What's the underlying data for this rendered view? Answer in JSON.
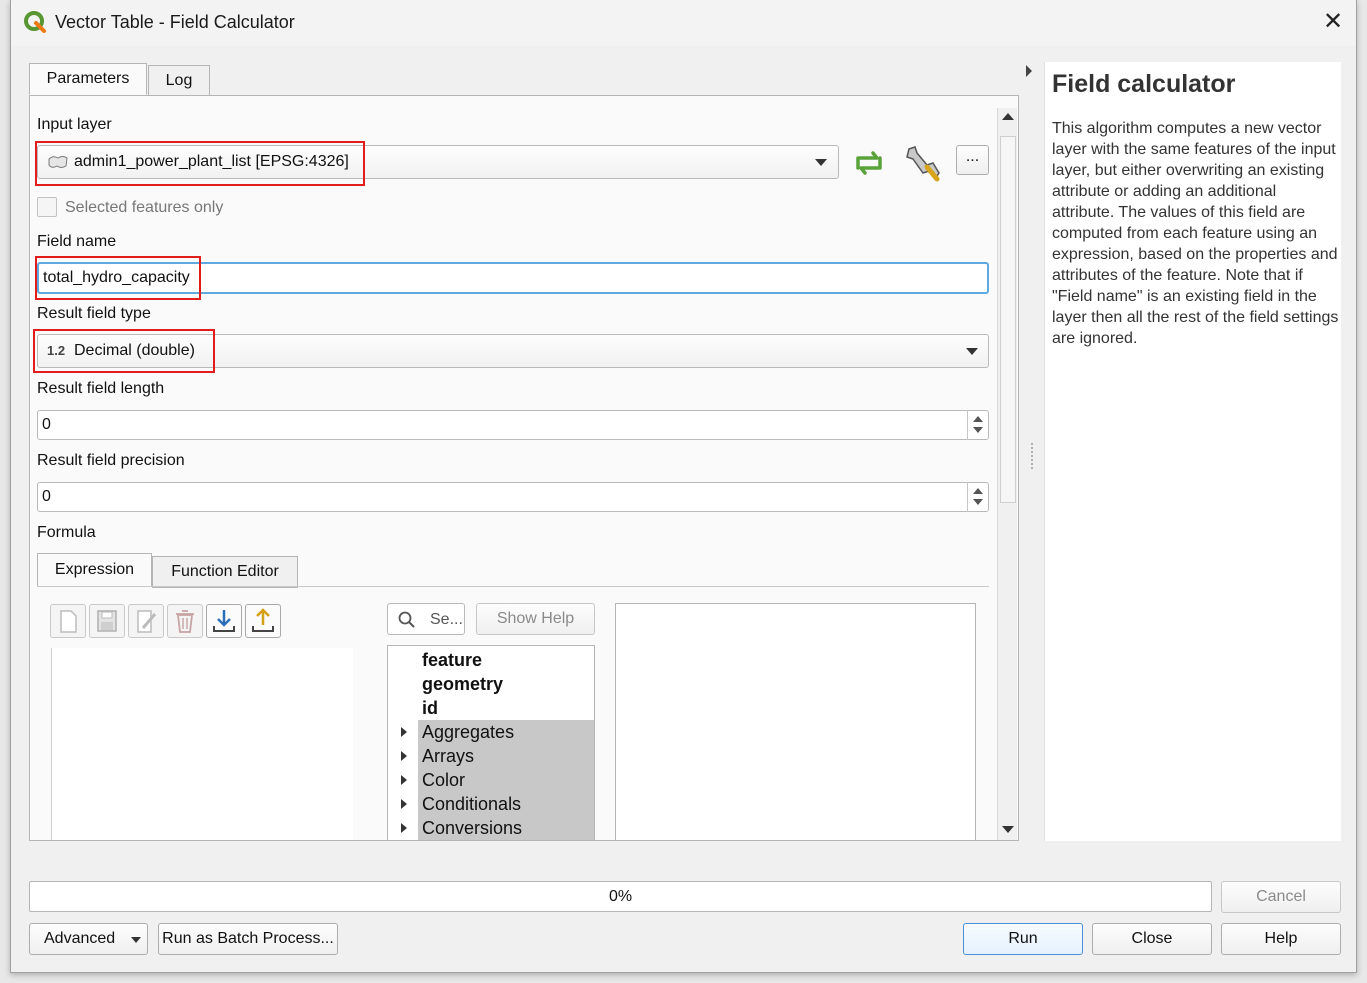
{
  "window": {
    "title": "Vector Table - Field Calculator"
  },
  "tabs": {
    "parameters": "Parameters",
    "log": "Log"
  },
  "input_layer": {
    "label": "Input layer",
    "value": "admin1_power_plant_list [EPSG:4326]",
    "more": "..."
  },
  "selected_only": {
    "label": "Selected features only",
    "checked": false
  },
  "field_name": {
    "label": "Field name",
    "value": "total_hydro_capacity"
  },
  "result_type": {
    "label": "Result field type",
    "icon_text": "1.2",
    "value": "Decimal (double)"
  },
  "field_length": {
    "label": "Result field length",
    "value": "0"
  },
  "field_precision": {
    "label": "Result field precision",
    "value": "0"
  },
  "formula": {
    "label": "Formula",
    "tabs": {
      "expression": "Expression",
      "function_editor": "Function Editor"
    },
    "search_placeholder": "Se...",
    "show_help": "Show Help",
    "tree_items": [
      {
        "label": "feature",
        "bold": true,
        "expandable": false
      },
      {
        "label": "geometry",
        "bold": true,
        "expandable": false
      },
      {
        "label": "id",
        "bold": true,
        "expandable": false
      },
      {
        "label": "Aggregates",
        "bold": false,
        "expandable": true
      },
      {
        "label": "Arrays",
        "bold": false,
        "expandable": true
      },
      {
        "label": "Color",
        "bold": false,
        "expandable": true
      },
      {
        "label": "Conditionals",
        "bold": false,
        "expandable": true
      },
      {
        "label": "Conversions",
        "bold": false,
        "expandable": true
      }
    ]
  },
  "help_panel": {
    "title": "Field calculator",
    "body": "This algorithm computes a new vector layer with the same features of the input layer, but either overwriting an existing attribute or adding an additional attribute. The values of this field are computed from each feature using an expression, based on the properties and attributes of the feature. Note that if \"Field name\" is an existing field in the layer then all the rest of the field settings are ignored."
  },
  "progress": {
    "value": 0,
    "label": "0%"
  },
  "buttons": {
    "cancel": "Cancel",
    "advanced": "Advanced",
    "batch": "Run as Batch Process...",
    "run": "Run",
    "close": "Close",
    "help": "Help"
  },
  "colors": {
    "highlight": "#e21b1b",
    "focus": "#5fa8e0",
    "tree_grey": "#c8c8c8",
    "qgis_green": "#589632"
  }
}
